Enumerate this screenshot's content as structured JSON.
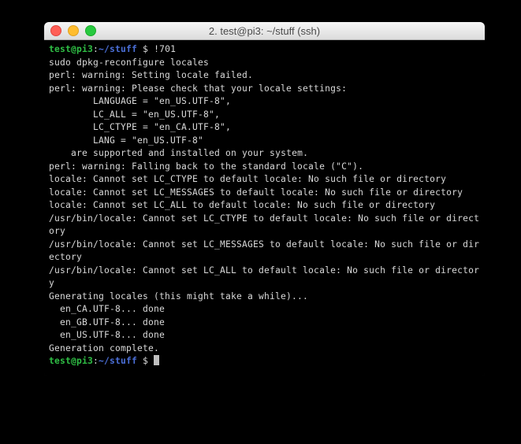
{
  "window": {
    "title": "2. test@pi3: ~/stuff (ssh)"
  },
  "prompt": {
    "user_host": "test@pi3",
    "colon": ":",
    "path": "~/stuff",
    "symbol": " $ "
  },
  "command": "!701",
  "output": {
    "l0": "sudo dpkg-reconfigure locales",
    "l1": "perl: warning: Setting locale failed.",
    "l2": "perl: warning: Please check that your locale settings:",
    "l3": "        LANGUAGE = \"en_US.UTF-8\",",
    "l4": "        LC_ALL = \"en_US.UTF-8\",",
    "l5": "        LC_CTYPE = \"en_CA.UTF-8\",",
    "l6": "        LANG = \"en_US.UTF-8\"",
    "l7": "    are supported and installed on your system.",
    "l8": "perl: warning: Falling back to the standard locale (\"C\").",
    "l9": "locale: Cannot set LC_CTYPE to default locale: No such file or directory",
    "l10": "locale: Cannot set LC_MESSAGES to default locale: No such file or directory",
    "l11": "locale: Cannot set LC_ALL to default locale: No such file or directory",
    "l12": "/usr/bin/locale: Cannot set LC_CTYPE to default locale: No such file or directory",
    "l13": "/usr/bin/locale: Cannot set LC_MESSAGES to default locale: No such file or directory",
    "l14": "/usr/bin/locale: Cannot set LC_ALL to default locale: No such file or directory",
    "l15": "Generating locales (this might take a while)...",
    "l16": "  en_CA.UTF-8... done",
    "l17": "  en_GB.UTF-8... done",
    "l18": "  en_US.UTF-8... done",
    "l19": "Generation complete."
  }
}
